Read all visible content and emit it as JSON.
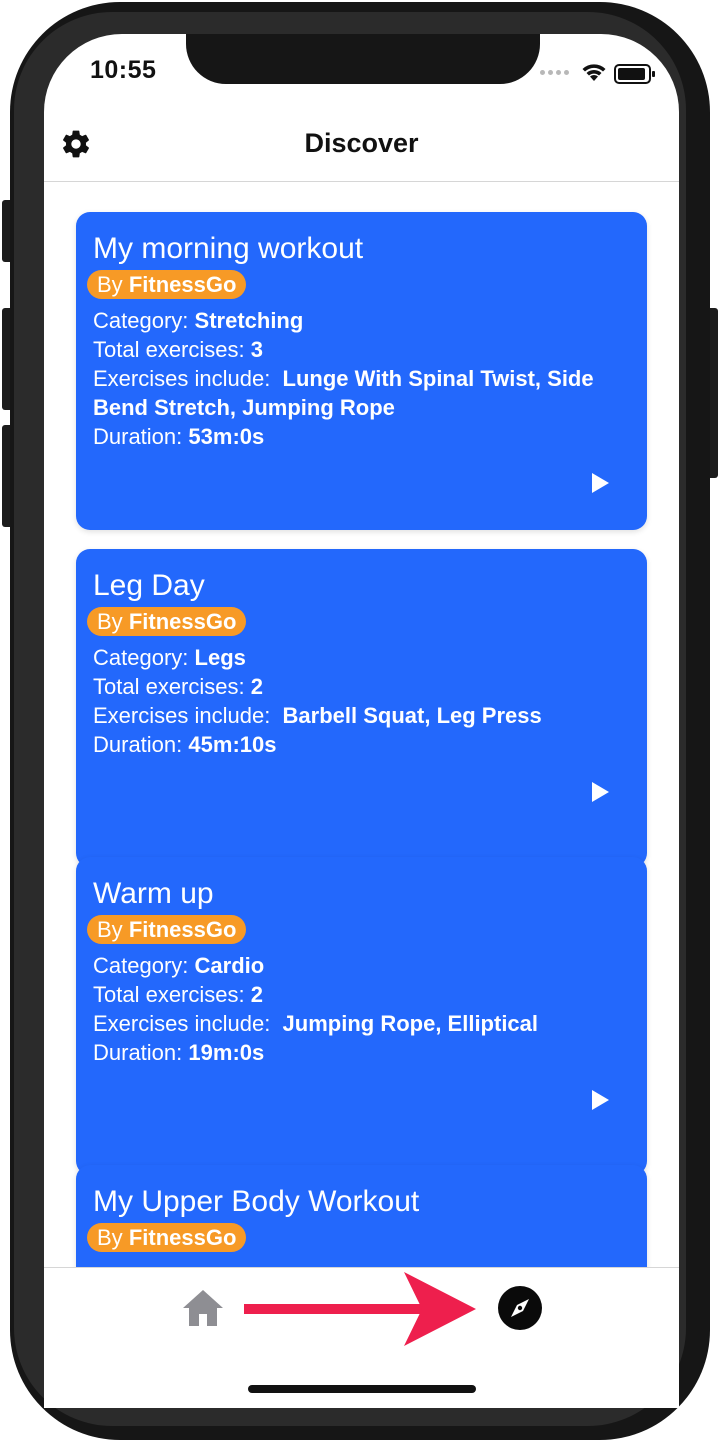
{
  "status": {
    "time": "10:55"
  },
  "header": {
    "title": "Discover"
  },
  "workouts": [
    {
      "title": "My morning workout",
      "by_prefix": "By",
      "author": "FitnessGo",
      "category_label": "Category:",
      "category": "Stretching",
      "total_label": "Total exercises:",
      "total": "3",
      "exercises_label": "Exercises include:",
      "exercises": "Lunge With Spinal Twist, Side Bend Stretch, Jumping Rope",
      "duration_label": "Duration:",
      "duration": "53m:0s"
    },
    {
      "title": "Leg Day",
      "by_prefix": "By",
      "author": "FitnessGo",
      "category_label": "Category:",
      "category": "Legs",
      "total_label": "Total exercises:",
      "total": "2",
      "exercises_label": "Exercises include:",
      "exercises": "Barbell Squat, Leg Press",
      "duration_label": "Duration:",
      "duration": "45m:10s"
    },
    {
      "title": "Warm up",
      "by_prefix": "By",
      "author": "FitnessGo",
      "category_label": "Category:",
      "category": "Cardio",
      "total_label": "Total exercises:",
      "total": "2",
      "exercises_label": "Exercises include:",
      "exercises": "Jumping Rope, Elliptical",
      "duration_label": "Duration:",
      "duration": "19m:0s"
    },
    {
      "title": "My Upper Body Workout",
      "by_prefix": "By",
      "author": "FitnessGo"
    }
  ],
  "tabbar": {
    "tabs": [
      {
        "name": "home",
        "icon": "home-icon",
        "active": false
      },
      {
        "name": "discover",
        "icon": "compass-icon",
        "active": true
      }
    ]
  },
  "colors": {
    "card": "#2368fc",
    "badge": "#f79a26",
    "annotation_arrow": "#ee1f4d",
    "inactive_tab": "#8e8e93"
  }
}
